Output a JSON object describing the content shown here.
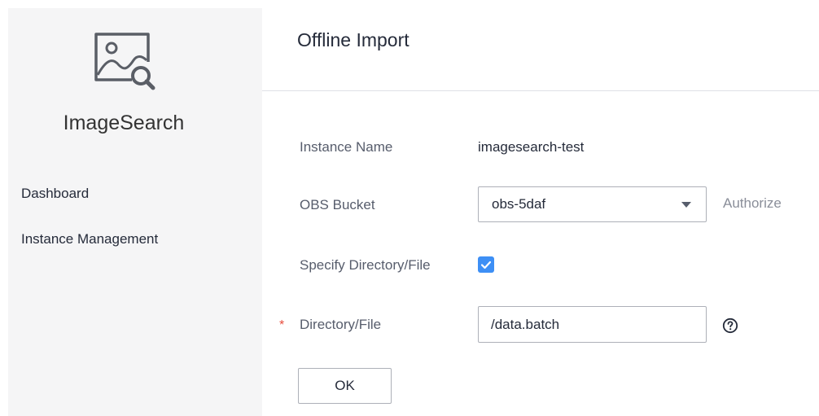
{
  "sidebar": {
    "logo_icon": "image-search-icon",
    "app_name": "ImageSearch",
    "items": [
      {
        "label": "Dashboard"
      },
      {
        "label": "Instance Management"
      }
    ]
  },
  "header": {
    "title": "Offline Import"
  },
  "form": {
    "instance_name": {
      "label": "Instance Name",
      "value": "imagesearch-test"
    },
    "obs_bucket": {
      "label": "OBS Bucket",
      "value": "obs-5daf",
      "authorize_link": "Authorize"
    },
    "specify_dir": {
      "label": "Specify Directory/File",
      "checked": true
    },
    "directory": {
      "label": "Directory/File",
      "required": true,
      "required_mark": "*",
      "value": "/data.batch"
    },
    "ok_label": "OK"
  },
  "colors": {
    "accent": "#3d8ff5",
    "required": "#e74c3c",
    "sidebar_bg": "#f5f5f6"
  }
}
